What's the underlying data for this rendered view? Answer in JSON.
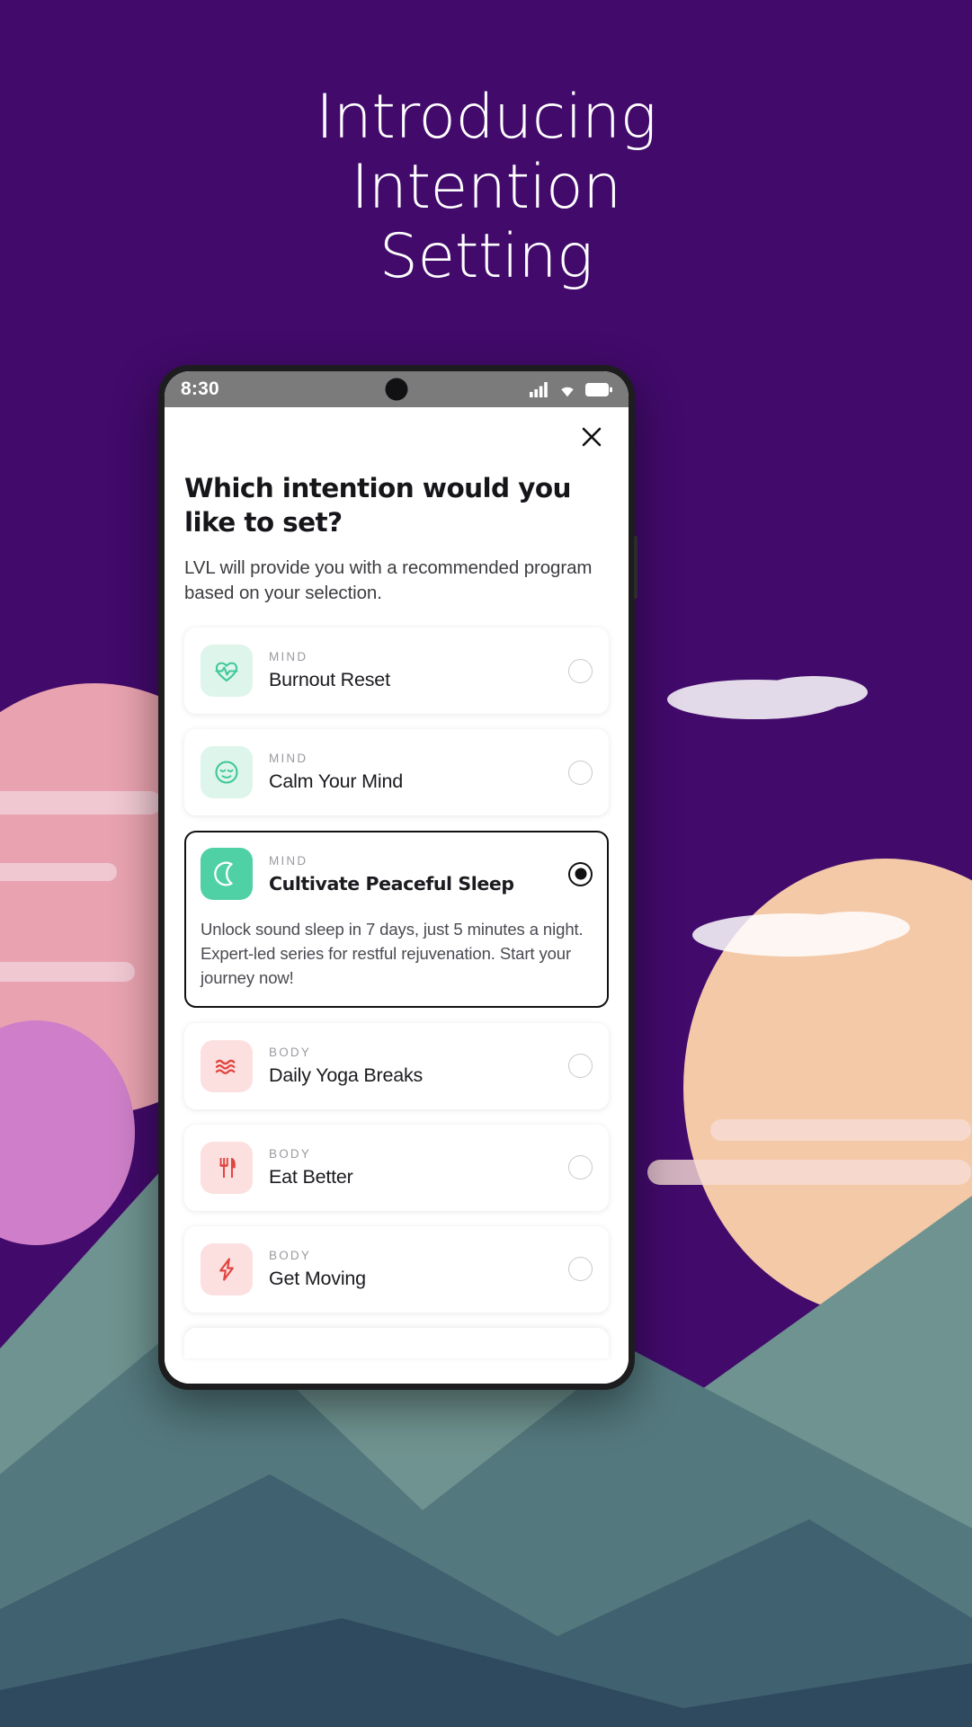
{
  "hero": {
    "lines": [
      "Introducing",
      "Intention",
      "Setting"
    ],
    "color": "#ffffff"
  },
  "background": {
    "color": "#420a6b"
  },
  "phone": {
    "statusbar": {
      "time": "8:30",
      "background": "#7b7b7b",
      "icons": [
        "signal-icon",
        "wifi-icon",
        "battery-icon"
      ]
    }
  },
  "screen": {
    "close_label": "✕",
    "headline": "Which intention would you like to set?",
    "subtext": "LVL will provide you with a recommended program based on your selection.",
    "accent_mind": "#4fd1a5",
    "accent_body": "#e2453f",
    "cards": [
      {
        "category": "MIND",
        "title": "Burnout Reset",
        "icon": "heart-pulse-icon",
        "tile": "mind",
        "selected": false,
        "description": ""
      },
      {
        "category": "MIND",
        "title": "Calm Your Mind",
        "icon": "calm-face-icon",
        "tile": "mind",
        "selected": false,
        "description": ""
      },
      {
        "category": "MIND",
        "title": "Cultivate Peaceful Sleep",
        "icon": "moon-icon",
        "tile": "solid",
        "selected": true,
        "description": "Unlock sound sleep in 7 days, just 5 minutes a night. Expert-led series for restful rejuvenation. Start your journey now!"
      },
      {
        "category": "BODY",
        "title": "Daily Yoga Breaks",
        "icon": "waves-icon",
        "tile": "body",
        "selected": false,
        "description": ""
      },
      {
        "category": "BODY",
        "title": "Eat Better",
        "icon": "fork-knife-icon",
        "tile": "body",
        "selected": false,
        "description": ""
      },
      {
        "category": "BODY",
        "title": "Get Moving",
        "icon": "lightning-bolt-icon",
        "tile": "body",
        "selected": false,
        "description": ""
      }
    ]
  }
}
